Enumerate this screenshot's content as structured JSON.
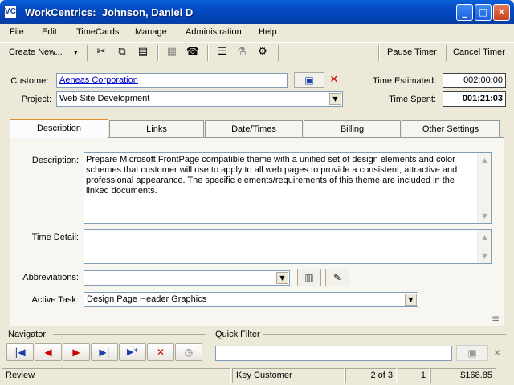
{
  "window": {
    "app_icon": "VC",
    "title": "WorkCentrics:  Johnson, Daniel D",
    "controls": {
      "minimize": "_",
      "maximize": "□",
      "close": "✕"
    }
  },
  "menubar": [
    "File",
    "Edit",
    "TimeCards",
    "Manage",
    "Administration",
    "Help"
  ],
  "toolbar": {
    "create_new_label": "Create New...",
    "create_new_arrow": "▾",
    "icons": {
      "cut": "✂",
      "copy": "⧉",
      "paste": "▤",
      "note": "▦",
      "phone": "☎",
      "flask": "⚗",
      "list": "☰",
      "options": "⚙"
    },
    "pause_timer_label": "Pause Timer",
    "cancel_timer_label": "Cancel Timer"
  },
  "header": {
    "customer_label": "Customer:",
    "customer_value": "Aeneas Corporation",
    "customer_card_icon": "▣",
    "clear_icon": "✕",
    "project_label": "Project:",
    "project_value": "Web Site Development",
    "combo_arrow": "▼",
    "time_estimated_label": "Time Estimated:",
    "time_estimated_value": "002:00:00",
    "time_spent_label": "Time Spent:",
    "time_spent_value": "001:21:03"
  },
  "tabs": [
    "Description",
    "Links",
    "Date/Times",
    "Billing",
    "Other Settings"
  ],
  "description_tab": {
    "description_label": "Description:",
    "description_text": "Prepare Microsoft FrontPage compatible theme with a unified set of design elements and color schemes that customer will use to apply to all web pages to provide a consistent, attractive and professional appearance.  The specific elements/requirements of this theme are included in the linked documents.",
    "time_detail_label": "Time Detail:",
    "time_detail_value": "",
    "abbreviations_label": "Abbreviations:",
    "abbreviations_value": "",
    "active_task_label": "Active Task:",
    "active_task_value": "Design Page Header Graphics",
    "scroll_up": "▲",
    "scroll_down": "▼",
    "abbr_icons": {
      "insert": "▥",
      "edit": "✎"
    },
    "grip_icon": "≡"
  },
  "navigator": {
    "label": "Navigator",
    "buttons": {
      "first": "|◀",
      "prev": "◀",
      "next": "▶",
      "last": "▶|",
      "new": "▶*",
      "delete": "✕",
      "history": "◷"
    }
  },
  "quick_filter": {
    "label": "Quick Filter",
    "value": "",
    "card_icon": "▣",
    "clear_icon": "✕"
  },
  "statusbar": {
    "mode": "Review",
    "filter_name": "Key Customer",
    "record_position": "2 of 3",
    "count": "1",
    "amount": "$168.85"
  },
  "colors": {
    "title_bar": "#0349c2",
    "window_bg": "#ece9d8",
    "field_border": "#7f9db9",
    "link": "#0000cc",
    "nav_blue": "#1a3fa8",
    "nav_red": "#cc0000",
    "tab_active_accent": "#e68b2c"
  }
}
